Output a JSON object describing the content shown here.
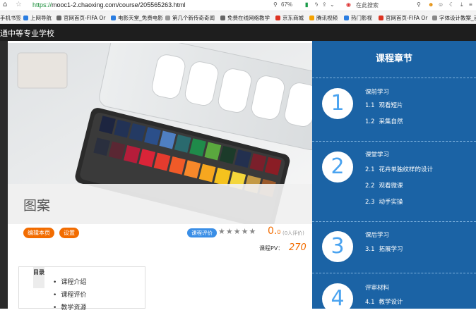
{
  "browser": {
    "url_scheme": "https://",
    "url_rest": "mooc1-2.chaoxing.com/course/205565263.html",
    "zoom": "67%",
    "search_hint": "在此搜索",
    "bookmarks": [
      "手机书签",
      "上网导航",
      "官网首页-FIFA Or",
      "电影天堂_免费电影",
      "第几个新传奇奇闻",
      "免费在线网络教学",
      "京东商城",
      "腾讯视频",
      "热门影视",
      "官网首页-FIFA Or",
      "字体设计教案_百"
    ]
  },
  "site": {
    "name": "通中等专业学校"
  },
  "course": {
    "title": "图案",
    "edit_button": "编辑本页",
    "settings_button": "设置",
    "review_label": "课程评价",
    "stars": "★★★★★",
    "score_int": "0.",
    "score_dec": "0",
    "rating_count": "(0人评价)",
    "pv_label": "课程PV：",
    "pv_value": "270"
  },
  "toc": {
    "tab_label": "目录",
    "items": [
      "课程介绍",
      "课程评价",
      "教学资源"
    ]
  },
  "chapters": {
    "heading": "课程章节",
    "groups": [
      {
        "num": "1",
        "title": "课前学习",
        "items": [
          {
            "n": "1.1",
            "t": "观看短片"
          },
          {
            "n": "1.2",
            "t": "采集自然"
          }
        ]
      },
      {
        "num": "2",
        "title": "课堂学习",
        "items": [
          {
            "n": "2.1",
            "t": "花卉单独纹样的设计"
          },
          {
            "n": "2.2",
            "t": "观看微课"
          },
          {
            "n": "2.3",
            "t": "动手实操"
          }
        ]
      },
      {
        "num": "3",
        "title": "课后学习",
        "items": [
          {
            "n": "3.1",
            "t": "拓展学习"
          }
        ]
      },
      {
        "num": "4",
        "title": "评审材料",
        "items": [
          {
            "n": "4.1",
            "t": "教学设计"
          }
        ]
      }
    ]
  },
  "colors": {
    "accent_orange": "#f26c00",
    "sidebar_blue": "#1b63a5",
    "circle_number": "#4aa3f0"
  }
}
